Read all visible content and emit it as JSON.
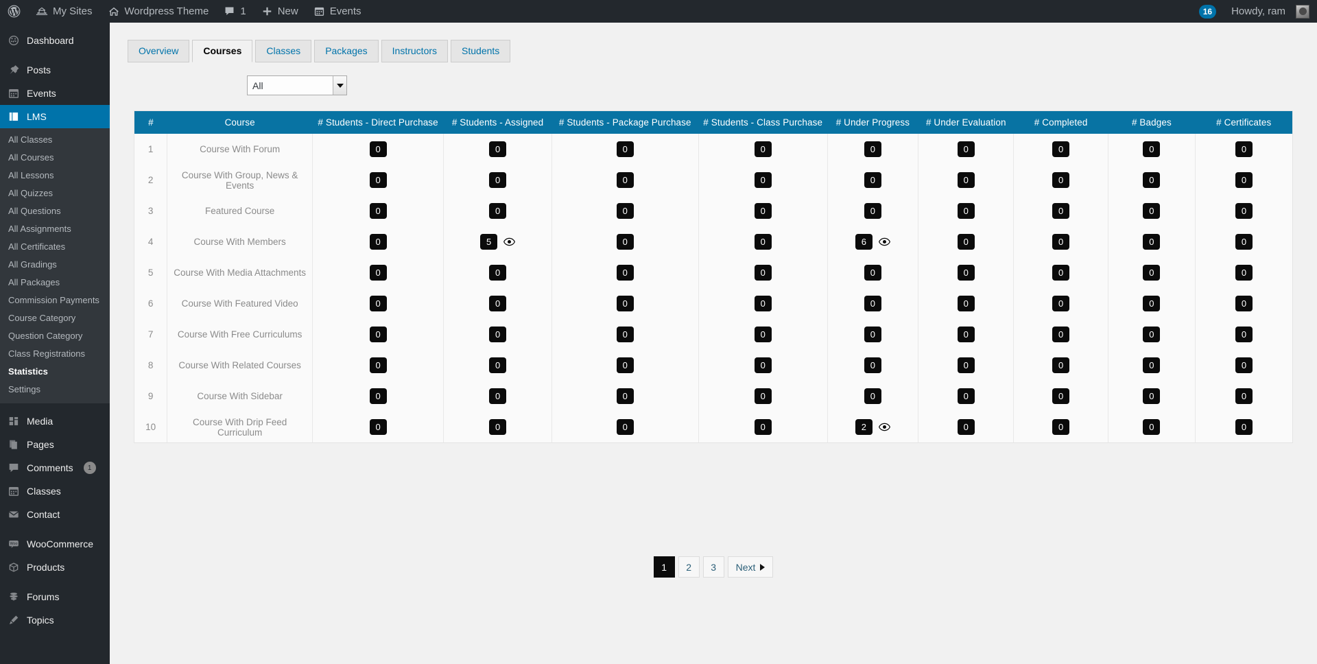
{
  "adminbar": {
    "left_items": [
      {
        "icon": "wordpress-logo-icon",
        "label": ""
      },
      {
        "icon": "my-sites-icon",
        "label": "My Sites"
      },
      {
        "icon": "home-icon",
        "label": "Wordpress Theme"
      },
      {
        "icon": "comment-icon",
        "label": "1"
      },
      {
        "icon": "plus-icon",
        "label": "New"
      },
      {
        "icon": "calendar-icon",
        "label": "Events"
      }
    ],
    "notification_count": "16",
    "howdy": "Howdy, ram"
  },
  "sidebar": {
    "items": [
      {
        "label": "Dashboard",
        "icon": "dashboard-icon",
        "current": false,
        "sep_after": true
      },
      {
        "label": "Posts",
        "icon": "pin-icon",
        "current": false,
        "sep_after": false
      },
      {
        "label": "Events",
        "icon": "calendar-icon",
        "current": false,
        "sep_after": false
      },
      {
        "label": "LMS",
        "icon": "book-icon",
        "current": true,
        "sep_after": false
      }
    ],
    "lms_submenu": [
      {
        "label": "All Classes",
        "current": false
      },
      {
        "label": "All Courses",
        "current": false
      },
      {
        "label": "All Lessons",
        "current": false
      },
      {
        "label": "All Quizzes",
        "current": false
      },
      {
        "label": "All Questions",
        "current": false
      },
      {
        "label": "All Assignments",
        "current": false
      },
      {
        "label": "All Certificates",
        "current": false
      },
      {
        "label": "All Gradings",
        "current": false
      },
      {
        "label": "All Packages",
        "current": false
      },
      {
        "label": "Commission Payments",
        "current": false
      },
      {
        "label": "Course Category",
        "current": false
      },
      {
        "label": "Question Category",
        "current": false
      },
      {
        "label": "Class Registrations",
        "current": false
      },
      {
        "label": "Statistics",
        "current": true
      },
      {
        "label": "Settings",
        "current": false
      }
    ],
    "items_after": [
      {
        "label": "Media",
        "icon": "media-icon",
        "badge": "",
        "sep_after": false
      },
      {
        "label": "Pages",
        "icon": "pages-icon",
        "badge": "",
        "sep_after": false
      },
      {
        "label": "Comments",
        "icon": "comment-icon",
        "badge": "1",
        "sep_after": false
      },
      {
        "label": "Classes",
        "icon": "calendar-icon",
        "badge": "",
        "sep_after": false
      },
      {
        "label": "Contact",
        "icon": "envelope-icon",
        "badge": "",
        "sep_after": true
      },
      {
        "label": "WooCommerce",
        "icon": "woocommerce-icon",
        "badge": "",
        "sep_after": false
      },
      {
        "label": "Products",
        "icon": "box-icon",
        "badge": "",
        "sep_after": true
      },
      {
        "label": "Forums",
        "icon": "forums-icon",
        "badge": "",
        "sep_after": false
      },
      {
        "label": "Topics",
        "icon": "topics-icon",
        "badge": "",
        "sep_after": false
      }
    ]
  },
  "tabs": [
    {
      "label": "Overview",
      "active": false
    },
    {
      "label": "Courses",
      "active": true
    },
    {
      "label": "Classes",
      "active": false
    },
    {
      "label": "Packages",
      "active": false
    },
    {
      "label": "Instructors",
      "active": false
    },
    {
      "label": "Students",
      "active": false
    }
  ],
  "filter": {
    "selected": "All",
    "options": [
      "All"
    ]
  },
  "table": {
    "columns": [
      "#",
      "Course",
      "# Students - Direct Purchase",
      "# Students - Assigned",
      "# Students - Package Purchase",
      "# Students - Class Purchase",
      "# Under Progress",
      "# Under Evaluation",
      "# Completed",
      "# Badges",
      "# Certificates"
    ],
    "rows": [
      {
        "idx": "1",
        "course": "Course With Forum",
        "direct": "0",
        "assigned": "0",
        "package": "0",
        "class": "0",
        "progress": "0",
        "evaluation": "0",
        "completed": "0",
        "badges": "0",
        "certificates": "0",
        "assigned_eye": false,
        "progress_eye": false
      },
      {
        "idx": "2",
        "course": "Course With Group, News & Events",
        "direct": "0",
        "assigned": "0",
        "package": "0",
        "class": "0",
        "progress": "0",
        "evaluation": "0",
        "completed": "0",
        "badges": "0",
        "certificates": "0",
        "assigned_eye": false,
        "progress_eye": false
      },
      {
        "idx": "3",
        "course": "Featured Course",
        "direct": "0",
        "assigned": "0",
        "package": "0",
        "class": "0",
        "progress": "0",
        "evaluation": "0",
        "completed": "0",
        "badges": "0",
        "certificates": "0",
        "assigned_eye": false,
        "progress_eye": false
      },
      {
        "idx": "4",
        "course": "Course With Members",
        "direct": "0",
        "assigned": "5",
        "package": "0",
        "class": "0",
        "progress": "6",
        "evaluation": "0",
        "completed": "0",
        "badges": "0",
        "certificates": "0",
        "assigned_eye": true,
        "progress_eye": true
      },
      {
        "idx": "5",
        "course": "Course With Media Attachments",
        "direct": "0",
        "assigned": "0",
        "package": "0",
        "class": "0",
        "progress": "0",
        "evaluation": "0",
        "completed": "0",
        "badges": "0",
        "certificates": "0",
        "assigned_eye": false,
        "progress_eye": false
      },
      {
        "idx": "6",
        "course": "Course With Featured Video",
        "direct": "0",
        "assigned": "0",
        "package": "0",
        "class": "0",
        "progress": "0",
        "evaluation": "0",
        "completed": "0",
        "badges": "0",
        "certificates": "0",
        "assigned_eye": false,
        "progress_eye": false
      },
      {
        "idx": "7",
        "course": "Course With Free Curriculums",
        "direct": "0",
        "assigned": "0",
        "package": "0",
        "class": "0",
        "progress": "0",
        "evaluation": "0",
        "completed": "0",
        "badges": "0",
        "certificates": "0",
        "assigned_eye": false,
        "progress_eye": false
      },
      {
        "idx": "8",
        "course": "Course With Related Courses",
        "direct": "0",
        "assigned": "0",
        "package": "0",
        "class": "0",
        "progress": "0",
        "evaluation": "0",
        "completed": "0",
        "badges": "0",
        "certificates": "0",
        "assigned_eye": false,
        "progress_eye": false
      },
      {
        "idx": "9",
        "course": "Course With Sidebar",
        "direct": "0",
        "assigned": "0",
        "package": "0",
        "class": "0",
        "progress": "0",
        "evaluation": "0",
        "completed": "0",
        "badges": "0",
        "certificates": "0",
        "assigned_eye": false,
        "progress_eye": false
      },
      {
        "idx": "10",
        "course": "Course With Drip Feed Curriculum",
        "direct": "0",
        "assigned": "0",
        "package": "0",
        "class": "0",
        "progress": "2",
        "evaluation": "0",
        "completed": "0",
        "badges": "0",
        "certificates": "0",
        "assigned_eye": false,
        "progress_eye": true
      }
    ]
  },
  "pagination": {
    "pages": [
      {
        "label": "1",
        "active": true
      },
      {
        "label": "2",
        "active": false
      },
      {
        "label": "3",
        "active": false
      }
    ],
    "next_label": "Next"
  },
  "colors": {
    "adminbar_bg": "#23282d",
    "sidebar_bg": "#23282d",
    "submenu_bg": "#32373c",
    "accent": "#0073aa",
    "table_header_bg": "#0873a3",
    "pill_bg": "#0b0b0b",
    "content_bg": "#f1f1f1"
  }
}
